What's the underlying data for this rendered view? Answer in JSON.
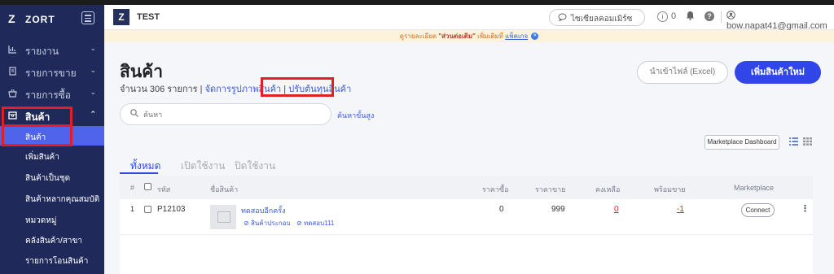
{
  "app": {
    "brand_logo": "Z",
    "brand_name": "ZORT"
  },
  "sidebar": {
    "items": [
      {
        "label": "รายงาน",
        "icon": "chart-icon"
      },
      {
        "label": "รายการขาย",
        "icon": "receipt-icon"
      },
      {
        "label": "รายการซื้อ",
        "icon": "basket-icon"
      },
      {
        "label": "สินค้า",
        "icon": "box-icon"
      }
    ],
    "sub_items": [
      {
        "label": "สินค้า"
      },
      {
        "label": "เพิ่มสินค้า"
      },
      {
        "label": "สินค้าเป็นชุด"
      },
      {
        "label": "สินค้าหลากคุณสมบัติ"
      },
      {
        "label": "หมวดหมู่"
      },
      {
        "label": "คลังสินค้า/สาขา"
      },
      {
        "label": "รายการโอนสินค้า"
      }
    ]
  },
  "header": {
    "shop_logo": "Z",
    "shop_name": "TEST",
    "compare_label": "ไซเซียลคอมเมิร์ซ",
    "notification_count": "0",
    "user_email": "bow.napat41@gmail.com"
  },
  "notice": {
    "text_before": "ดูรายละเอียด ",
    "bold_text": "\"ส่วนต่อเติม\"",
    "text_mid": " เพิ่มเติมที่ ",
    "link_text": "แพ็คเกจ"
  },
  "page": {
    "title": "สินค้า",
    "count_text": "จำนวน 306 รายการ | ",
    "manage_images_link": "จัดการรูปภาพสินค้า",
    "separator": " | ",
    "adjust_cost_link": "ปรับต้นทุนสินค้า",
    "import_button": "นำเข้าไฟล์ (Excel)",
    "add_button": "เพิ่มสินค้าใหม่",
    "search_placeholder": "ค้นหา",
    "advanced_search": "ค้นหาขั้นสูง",
    "marketplace_dashboard": "Marketplace Dashboard"
  },
  "tabs": [
    {
      "label": "ทั้งหมด"
    },
    {
      "label": "เปิดใช้งาน"
    },
    {
      "label": "ปิดใช้งาน"
    }
  ],
  "table": {
    "headers": {
      "index": "#",
      "code": "รหัส",
      "name": "ชื่อสินค้า",
      "buy_price": "ราคาซื้อ",
      "sell_price": "ราคาขาย",
      "remaining": "คงเหลือ",
      "ready": "พร้อมขาย",
      "marketplace": "Marketplace"
    },
    "rows": [
      {
        "index": "1",
        "code": "P12103",
        "name": "ทดสอบอีกครั้ง",
        "tags": [
          "สินค้าประกอบ",
          "ทดสอบ111"
        ],
        "buy_price": "0",
        "sell_price": "999",
        "remaining": "0",
        "ready": "-1",
        "marketplace_button": "Connect"
      }
    ]
  },
  "colors": {
    "sidebar_bg": "#1f2a5a",
    "accent": "#3146e8",
    "highlight_box": "#e41e26"
  }
}
